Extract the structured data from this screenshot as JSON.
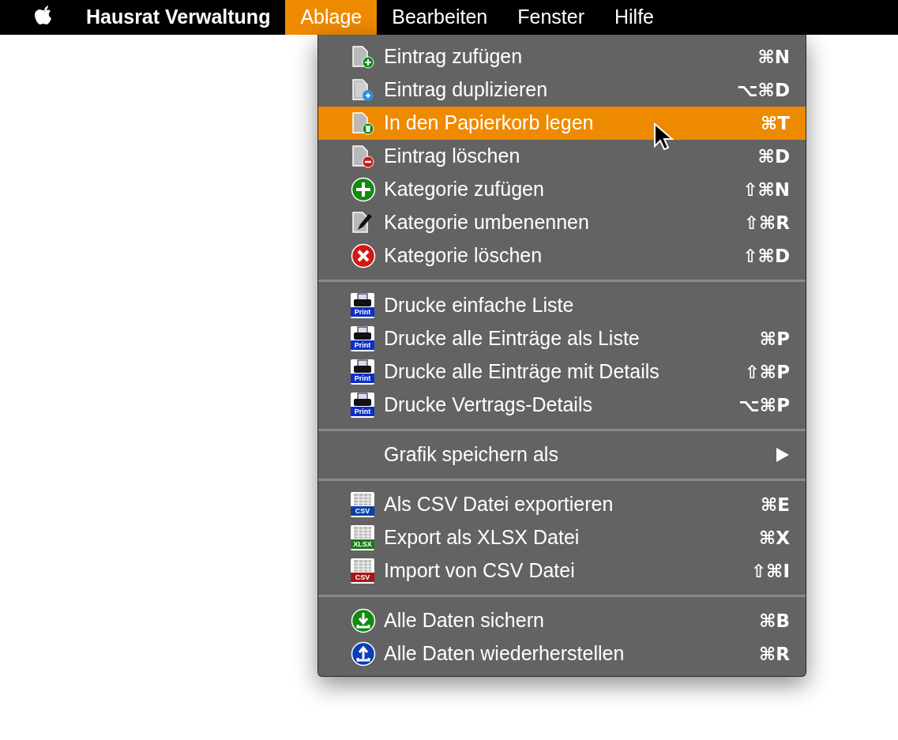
{
  "menu_bar": {
    "app_name": "Hausrat Verwaltung",
    "menus": [
      {
        "label": "Ablage",
        "selected": true
      },
      {
        "label": "Bearbeiten",
        "selected": false
      },
      {
        "label": "Fenster",
        "selected": false
      },
      {
        "label": "Hilfe",
        "selected": false
      }
    ]
  },
  "dropdown": {
    "sections": [
      {
        "items": [
          {
            "label": "Eintrag zufügen",
            "shortcut": "⌘N",
            "kind": "doc-plus",
            "selected": false
          },
          {
            "label": "Eintrag duplizieren",
            "shortcut": "⌥⌘D",
            "kind": "doc-copy",
            "selected": false
          },
          {
            "label": "In den Papierkorb legen",
            "shortcut": "⌘T",
            "kind": "doc-trash",
            "selected": true
          },
          {
            "label": "Eintrag löschen",
            "shortcut": "⌘D",
            "kind": "doc-minus",
            "selected": false
          },
          {
            "label": "Kategorie zufügen",
            "shortcut": "⇧⌘N",
            "kind": "circle-plus",
            "selected": false
          },
          {
            "label": "Kategorie umbenennen",
            "shortcut": "⇧⌘R",
            "kind": "doc-pen",
            "selected": false
          },
          {
            "label": "Kategorie löschen",
            "shortcut": "⇧⌘D",
            "kind": "circle-x",
            "selected": false
          }
        ]
      },
      {
        "items": [
          {
            "label": "Drucke einfache Liste",
            "kind": "print",
            "badge": "Print",
            "selected": false
          },
          {
            "label": "Drucke alle Einträge als Liste",
            "shortcut": "⌘P",
            "kind": "print",
            "badge": "Print",
            "selected": false
          },
          {
            "label": "Drucke alle Einträge mit Details",
            "shortcut": "⇧⌘P",
            "kind": "print",
            "badge": "Print",
            "selected": false
          },
          {
            "label": "Drucke Vertrags-Details",
            "shortcut": "⌥⌘P",
            "kind": "print",
            "badge": "Print",
            "selected": false
          }
        ]
      },
      {
        "items": [
          {
            "label": "Grafik speichern als",
            "kind": "submenu",
            "selected": false
          }
        ]
      },
      {
        "items": [
          {
            "label": "Als CSV Datei exportieren",
            "shortcut": "⌘E",
            "kind": "sheet",
            "badge": "CSV",
            "color": "#0a3fa8",
            "selected": false
          },
          {
            "label": "Export als XLSX Datei",
            "shortcut": "⌘X",
            "kind": "sheet",
            "badge": "XLSX",
            "color": "#1c7a1c",
            "selected": false
          },
          {
            "label": "Import von CSV Datei",
            "shortcut": "⇧⌘I",
            "kind": "sheet",
            "badge": "CSV",
            "color": "#a81616",
            "selected": false
          }
        ]
      },
      {
        "items": [
          {
            "label": "Alle Daten sichern",
            "shortcut": "⌘B",
            "kind": "circle-down",
            "selected": false
          },
          {
            "label": "Alle Daten wiederherstellen",
            "shortcut": "⌘R",
            "kind": "circle-up",
            "selected": false
          }
        ]
      }
    ]
  }
}
